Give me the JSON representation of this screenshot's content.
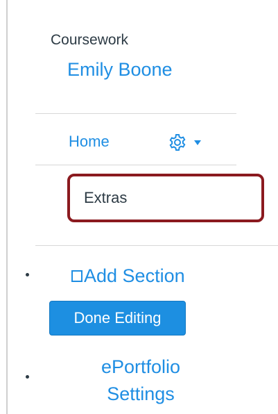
{
  "sidebar": {
    "owner_label": "Coursework",
    "owner_name": "Emily Boone",
    "items": [
      {
        "label": "Home"
      },
      {
        "label": "Extras"
      }
    ],
    "add_section": {
      "icon": "checkbox-outline-icon",
      "label": "Add Section"
    },
    "done_editing": "Done Editing",
    "eportfolio_settings": {
      "line1": "ePortfolio",
      "line2": "Settings"
    }
  },
  "colors": {
    "link": "#1f8ee3",
    "text": "#2d3b45",
    "button_bg": "#1d8fe1",
    "highlight_border": "#8b1a1f"
  }
}
